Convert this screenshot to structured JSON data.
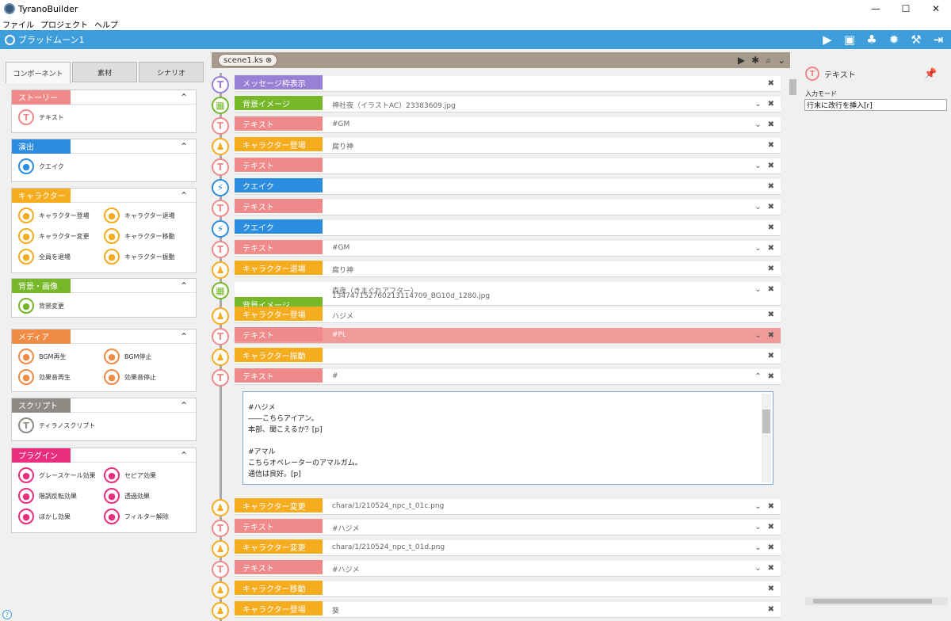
{
  "window": {
    "title": "TyranoBuilder",
    "min": "—",
    "max": "☐",
    "close": "✕"
  },
  "menu": [
    "ファイル",
    "プロジェクト",
    "ヘルプ"
  ],
  "project": {
    "name": "ブラッドムーン1"
  },
  "toolbar_icons": [
    "play-icon",
    "save-icon",
    "characters-gear-icon",
    "settings-gear-icon",
    "build-hammer-icon",
    "export-icon"
  ],
  "tabs": [
    "コンポーネント",
    "素材",
    "シナリオ"
  ],
  "categories": [
    {
      "label": "ストーリー",
      "color": "#f08a8a",
      "items": [
        "テキスト"
      ]
    },
    {
      "label": "演出",
      "color": "#2b8de0",
      "items": [
        "クエイク"
      ]
    },
    {
      "label": "キャラクター",
      "color": "#f5ac1e",
      "items": [
        "キャラクター登場",
        "キャラクター退場",
        "キャラクター変更",
        "キャラクター移動",
        "全員を退場",
        "キャラクター振動"
      ]
    },
    {
      "label": "背景・画像",
      "color": "#76b82a",
      "items": [
        "背景変更"
      ]
    },
    {
      "label": "メディア",
      "color": "#f08b45",
      "items": [
        "BGM再生",
        "BGM停止",
        "効果音再生",
        "効果音停止"
      ]
    },
    {
      "label": "スクリプト",
      "color": "#8f8a84",
      "items": [
        "ティラノスクリプト"
      ]
    },
    {
      "label": "プラグイン",
      "color": "#ea2e7e",
      "items": [
        "グレースケール効果",
        "セピア効果",
        "階調反転効果",
        "透過効果",
        "ぼかし効果",
        "フィルター解除"
      ]
    }
  ],
  "scene": {
    "tab": "scene1.ks",
    "close": "⊗"
  },
  "script_rows": [
    {
      "label": "メッセージ枠表示",
      "value": "",
      "value2": "",
      "color": "#9a7fd6",
      "icon": "T"
    },
    {
      "label": "背景イメージ",
      "value": "神社夜（イラストAC）23383609.jpg",
      "value2": "",
      "color": "#76b82a",
      "icon": "▦"
    },
    {
      "label": "テキスト",
      "value": "#GM",
      "value2": "",
      "color": "#f08a8a",
      "icon": "T"
    },
    {
      "label": "キャラクター登場",
      "value": "腐り神",
      "value2": "",
      "color": "#f5ac1e",
      "icon": "♟"
    },
    {
      "label": "テキスト",
      "value": "",
      "value2": "",
      "color": "#f08a8a",
      "icon": "T"
    },
    {
      "label": "クエイク",
      "value": "",
      "value2": "",
      "color": "#2b8de0",
      "icon": "⚡"
    },
    {
      "label": "テキスト",
      "value": "",
      "value2": "",
      "color": "#f08a8a",
      "icon": "T"
    },
    {
      "label": "クエイク",
      "value": "",
      "value2": "",
      "color": "#2b8de0",
      "icon": "⚡"
    },
    {
      "label": "テキスト",
      "value": "#GM",
      "value2": "",
      "color": "#f08a8a",
      "icon": "T"
    },
    {
      "label": "キャラクター退場",
      "value": "腐り神",
      "value2": "",
      "color": "#f5ac1e",
      "icon": "♟"
    },
    {
      "label": "背景イメージ",
      "value": "森夜（きまぐれアフター）",
      "value2": "134747152760213114709_BG10d_1280.jpg",
      "color": "#76b82a",
      "icon": "▦"
    },
    {
      "label": "キャラクター登場",
      "value": "ハジメ",
      "value2": "",
      "color": "#f5ac1e",
      "icon": "♟"
    },
    {
      "label": "テキスト",
      "value": "#PL",
      "value2": "",
      "color": "#f08a8a",
      "icon": "T"
    },
    {
      "label": "キャラクター振動",
      "value": "",
      "value2": "",
      "color": "#f5ac1e",
      "icon": "♟"
    },
    {
      "label": "テキスト",
      "value": "#",
      "value2": "",
      "color": "#f08a8a",
      "icon": "T"
    },
    {
      "label": "キャラクター変更",
      "value": "chara/1/210524_npc_t_01c.png",
      "value2": "",
      "color": "#f5ac1e",
      "icon": "♟"
    },
    {
      "label": "テキスト",
      "value": "#ハジメ",
      "value2": "",
      "color": "#f08a8a",
      "icon": "T"
    },
    {
      "label": "キャラクター変更",
      "value": "chara/1/210524_npc_t_01d.png",
      "value2": "",
      "color": "#f5ac1e",
      "icon": "♟"
    },
    {
      "label": "テキスト",
      "value": "#ハジメ",
      "value2": "",
      "color": "#f08a8a",
      "icon": "T"
    },
    {
      "label": "キャラクター移動",
      "value": "",
      "value2": "",
      "color": "#f5ac1e",
      "icon": "♟"
    },
    {
      "label": "キャラクター登場",
      "value": "葵",
      "value2": "",
      "color": "#f5ac1e",
      "icon": "♟"
    }
  ],
  "editor_lines": [
    "#ハジメ",
    "――こちらアイアン。",
    "本部、聞こえるか？[p]",
    "",
    "#アマル",
    "こちらオペレーターのアマルガム。",
    "通信は良好。[p]"
  ],
  "right": {
    "title": "テキスト",
    "field_label": "入力モード",
    "field_value": "行末に改行を挿入[r]"
  },
  "help": "?"
}
